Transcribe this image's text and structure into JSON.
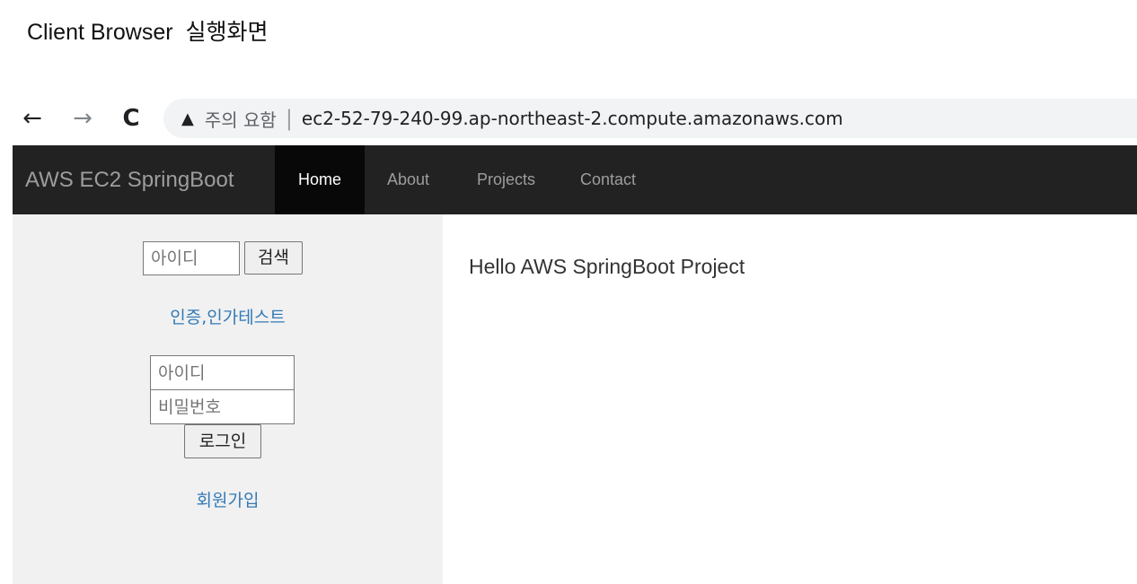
{
  "caption": "Client Browser  실행화면",
  "browser": {
    "back_icon": "←",
    "forward_icon": "→",
    "reload_icon": "C",
    "warning_icon": "▲",
    "security_text": "주의 요함",
    "separator": "|",
    "url": "ec2-52-79-240-99.ap-northeast-2.compute.amazonaws.com"
  },
  "navbar": {
    "brand": "AWS EC2 SpringBoot",
    "items": [
      {
        "label": "Home",
        "active": true
      },
      {
        "label": "About",
        "active": false
      },
      {
        "label": "Projects",
        "active": false
      },
      {
        "label": "Contact",
        "active": false
      }
    ]
  },
  "sidebar": {
    "search_placeholder": "아이디",
    "search_button": "검색",
    "auth_test_link": "인증,인가테스트",
    "login": {
      "id_placeholder": "아이디",
      "password_placeholder": "비밀번호",
      "submit_label": "로그인"
    },
    "signup_link": "회원가입"
  },
  "main": {
    "greeting": "Hello AWS SpringBoot Project"
  },
  "colors": {
    "navbar_bg": "#222222",
    "navbar_active_bg": "#080808",
    "sidebar_bg": "#f1f1f1",
    "link": "#337ab7"
  }
}
